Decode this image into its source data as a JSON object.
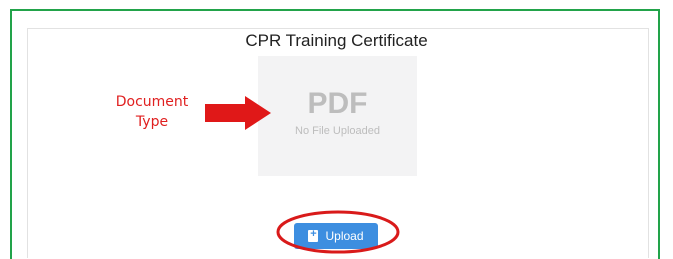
{
  "card": {
    "title": "CPR Training Certificate",
    "preview": {
      "type_label": "PDF",
      "status_text": "No File Uploaded"
    },
    "upload_button": {
      "label": "Upload",
      "icon": "upload-file-icon"
    }
  },
  "annotation": {
    "text": "Document\nType",
    "color": "#e02020"
  },
  "colors": {
    "frame_border": "#22a34a",
    "button_bg": "#3d8ee0",
    "annotation_red": "#e02020"
  }
}
